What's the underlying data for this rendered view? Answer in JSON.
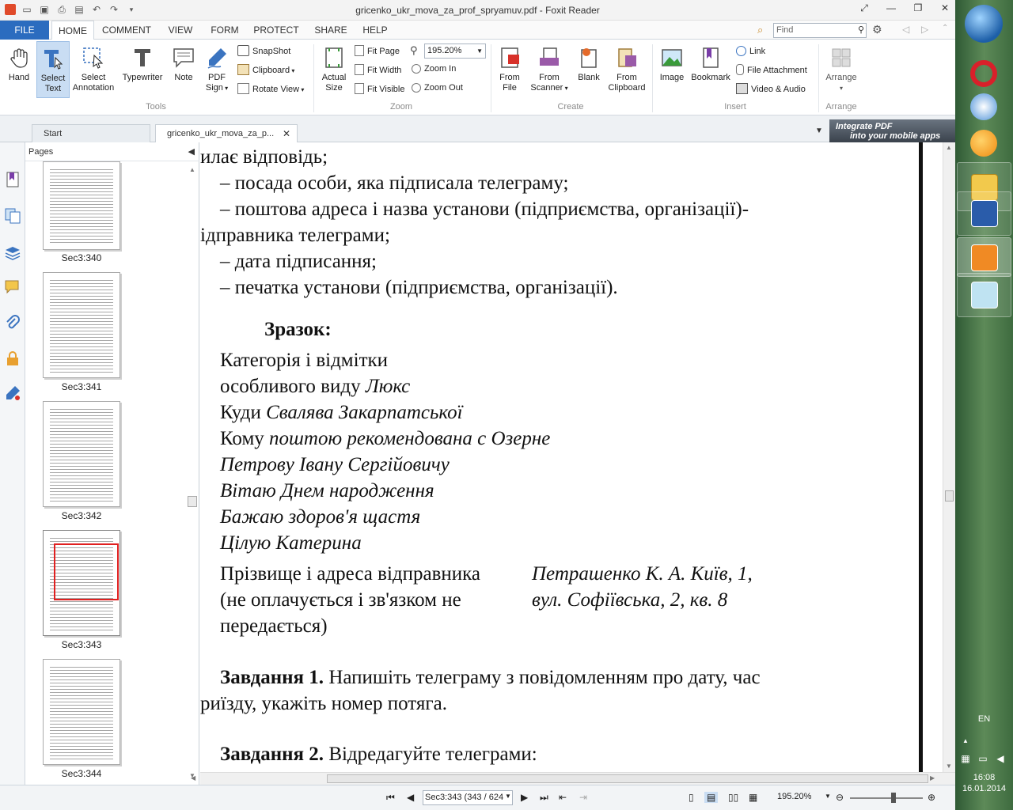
{
  "window": {
    "title": "gricenko_ukr_mova_za_prof_spryamuv.pdf - Foxit Reader"
  },
  "menu": {
    "tabs": [
      "FILE",
      "HOME",
      "COMMENT",
      "VIEW",
      "FORM",
      "PROTECT",
      "SHARE",
      "HELP"
    ],
    "find_placeholder": "Find"
  },
  "ribbon": {
    "tools": {
      "group": "Tools",
      "hand": "Hand",
      "select_text_1": "Select",
      "select_text_2": "Text",
      "select_annot_1": "Select",
      "select_annot_2": "Annotation",
      "typewriter": "Typewriter",
      "note": "Note",
      "pdf_sign_1": "PDF",
      "pdf_sign_2": "Sign",
      "snapshot": "SnapShot",
      "clipboard": "Clipboard",
      "rotate_view": "Rotate View"
    },
    "zoom": {
      "group": "Zoom",
      "actual_size_1": "Actual",
      "actual_size_2": "Size",
      "fit_page": "Fit Page",
      "fit_width": "Fit Width",
      "fit_visible": "Fit Visible",
      "zoom_value": "195.20%",
      "zoom_in": "Zoom In",
      "zoom_out": "Zoom Out"
    },
    "create": {
      "group": "Create",
      "from_file_1": "From",
      "from_file_2": "File",
      "from_scanner_1": "From",
      "from_scanner_2": "Scanner",
      "blank": "Blank",
      "from_clipboard_1": "From",
      "from_clipboard_2": "Clipboard"
    },
    "insert": {
      "group": "Insert",
      "image": "Image",
      "bookmark": "Bookmark",
      "link": "Link",
      "file_attachment": "File Attachment",
      "video_audio": "Video & Audio"
    },
    "arrange": {
      "group": "Arrange",
      "arrange": "Arrange"
    }
  },
  "doc_tabs": {
    "start": "Start",
    "doc": "gricenko_ukr_mova_za_p...",
    "banner_1": "Integrate PDF",
    "banner_2": "into your mobile apps"
  },
  "pages_panel": {
    "title": "Pages",
    "thumbnails": [
      "Sec3:340",
      "Sec3:341",
      "Sec3:342",
      "Sec3:343",
      "Sec3:344"
    ]
  },
  "document": {
    "lines": [
      "илає відповідь;",
      "– посада особи, яка підписала телеграму;",
      "– поштова адреса і назва установи (підприємства, організації)-",
      "ідправника телеграми;",
      "– дата підписання;",
      "– печатка установи (підприємства, організації)."
    ],
    "sample_heading": "Зразок:",
    "sample": {
      "category_1": "Категорія і відмітки",
      "category_2_label": "особливого виду ",
      "category_2_value": "Люкс",
      "where_label": "Куди ",
      "where_value": "Свалява Закарпатської",
      "to_label": "Кому ",
      "to_value": "поштою рекомендована с Озерне",
      "recipient": "Петрову Івану Сергійовичу",
      "msg_1": "Вітаю Днем народження",
      "msg_2": "Бажаю здоров'я щастя",
      "msg_3": "Цілую Катерина",
      "sender_label_1": "Прізвище і адреса відправника",
      "sender_label_2": "(не  оплачується  і  зв'язком  не",
      "sender_label_3": "передається)",
      "sender_value_1": "Петрашенко К. А. Київ, 1,",
      "sender_value_2": "вул. Софіївська, 2, кв. 8"
    },
    "task1_label": "Завдання 1.",
    "task1_text": " Напишіть телеграму з повідомленням про дату, час",
    "task1_text_2": "риїзду, укажіть номер потяга.",
    "task2_label": "Завдання 2.",
    "task2_text": " Відредагуйте телеграми:"
  },
  "statusbar": {
    "page_value": "Sec3:343 (343 / 624",
    "zoom_value": "195.20%"
  },
  "taskbar": {
    "lang": "EN",
    "time": "16:08",
    "date": "16.01.2014"
  }
}
